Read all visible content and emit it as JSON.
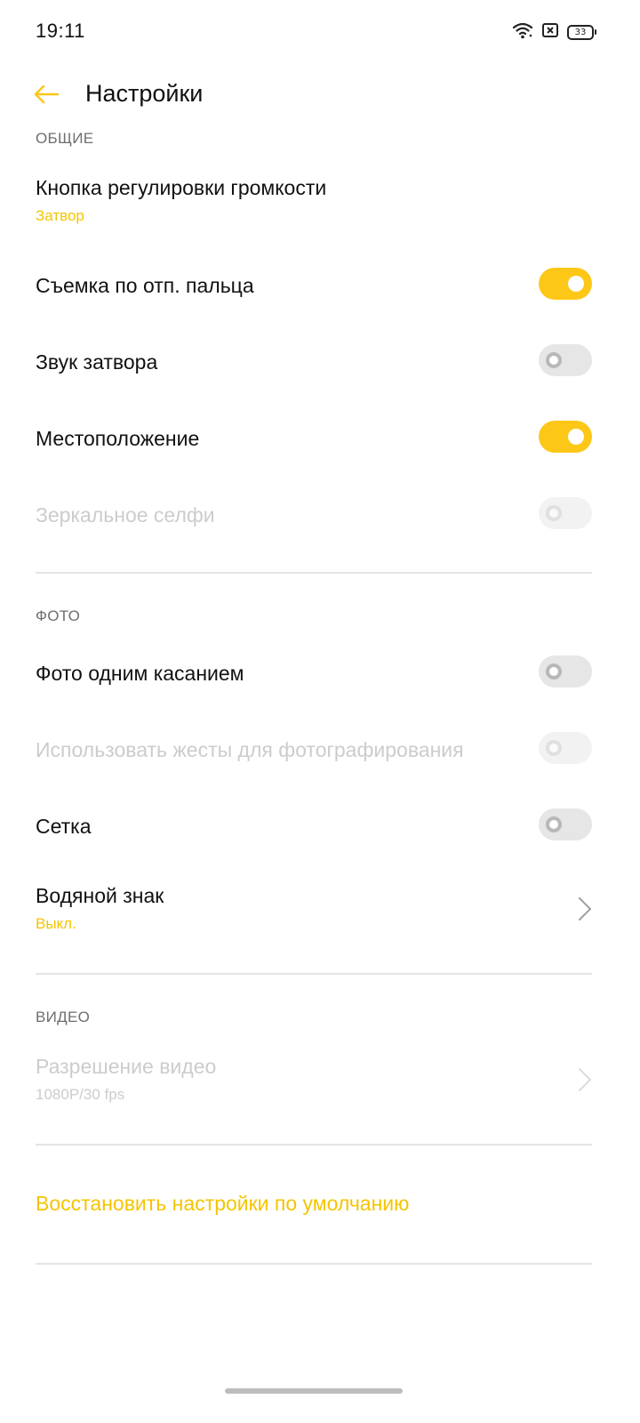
{
  "status_bar": {
    "time": "19:11",
    "battery_level": "33",
    "icons": [
      "wifi-icon",
      "sim-icon",
      "battery-icon"
    ]
  },
  "header": {
    "title": "Настройки",
    "back_icon": "arrow-left-icon",
    "accent_color": "#fdc718"
  },
  "sections": {
    "general": {
      "label": "ОБЩИЕ",
      "volume_button": {
        "title": "Кнопка регулировки громкости",
        "value": "Затвор"
      },
      "fingerprint_capture": {
        "title": "Съемка по отп. пальца",
        "enabled": true
      },
      "shutter_sound": {
        "title": "Звук затвора",
        "enabled": false
      },
      "location": {
        "title": "Местоположение",
        "enabled": true
      },
      "mirror_selfie": {
        "title": "Зеркальное селфи",
        "enabled": false,
        "disabled": true
      }
    },
    "photo": {
      "label": "ФОТО",
      "one_touch_photo": {
        "title": "Фото одним касанием",
        "enabled": false
      },
      "gesture_photo": {
        "title": "Использовать жесты для фотографирования",
        "enabled": false,
        "disabled": true
      },
      "grid": {
        "title": "Сетка",
        "enabled": false
      },
      "watermark": {
        "title": "Водяной знак",
        "value": "Выкл."
      }
    },
    "video": {
      "label": "ВИДЕО",
      "resolution": {
        "title": "Разрешение видео",
        "value": "1080P/30 fps",
        "disabled": true
      }
    }
  },
  "reset": {
    "label": "Восстановить настройки по умолчанию"
  }
}
